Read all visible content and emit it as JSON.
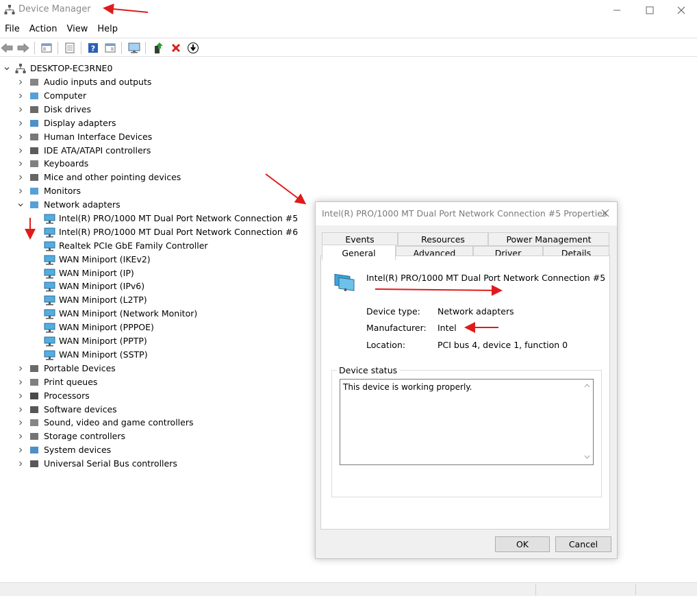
{
  "window": {
    "title": "Device Manager",
    "minimize_glyph": "—",
    "maximize_glyph": "□",
    "close_glyph": "✕"
  },
  "menu": [
    "File",
    "Action",
    "View",
    "Help"
  ],
  "toolbar": {
    "icons": [
      "back-icon",
      "forward-icon",
      "show-hide-tree-icon",
      "properties-icon",
      "help-icon",
      "action-pane-icon",
      "monitor-icon",
      "update-driver-icon",
      "uninstall-icon",
      "download-icon"
    ]
  },
  "tree": {
    "root": "DESKTOP-EC3RNE0",
    "categories": [
      "Audio inputs and outputs",
      "Computer",
      "Disk drives",
      "Display adapters",
      "Human Interface Devices",
      "IDE ATA/ATAPI controllers",
      "Keyboards",
      "Mice and other pointing devices",
      "Monitors",
      "Network adapters",
      "Portable Devices",
      "Print queues",
      "Processors",
      "Software devices",
      "Sound, video and game controllers",
      "Storage controllers",
      "System devices",
      "Universal Serial Bus controllers"
    ],
    "network_adapters": [
      "Intel(R) PRO/1000 MT Dual Port Network Connection #5",
      "Intel(R) PRO/1000 MT Dual Port Network Connection #6",
      "Realtek PCIe GbE Family Controller",
      "WAN Miniport (IKEv2)",
      "WAN Miniport (IP)",
      "WAN Miniport (IPv6)",
      "WAN Miniport (L2TP)",
      "WAN Miniport (Network Monitor)",
      "WAN Miniport (PPPOE)",
      "WAN Miniport (PPTP)",
      "WAN Miniport (SSTP)"
    ]
  },
  "dialog": {
    "title": "Intel(R) PRO/1000 MT Dual Port Network Connection #5 Properties",
    "tabs_row1": [
      "Events",
      "Resources",
      "Power Management"
    ],
    "tabs_row2": [
      "General",
      "Advanced",
      "Driver",
      "Details"
    ],
    "active_tab": "General",
    "device_name": "Intel(R) PRO/1000 MT Dual Port Network Connection #5",
    "props": {
      "device_type_label": "Device type:",
      "device_type_value": "Network adapters",
      "manufacturer_label": "Manufacturer:",
      "manufacturer_value": "Intel",
      "location_label": "Location:",
      "location_value": "PCI bus 4, device 1, function 0"
    },
    "status_group_label": "Device status",
    "status_text": "This device is working properly.",
    "ok_label": "OK",
    "cancel_label": "Cancel"
  },
  "colors": {
    "annotation_arrow": "#e01b1b",
    "title_gray": "#8a8a8a"
  }
}
